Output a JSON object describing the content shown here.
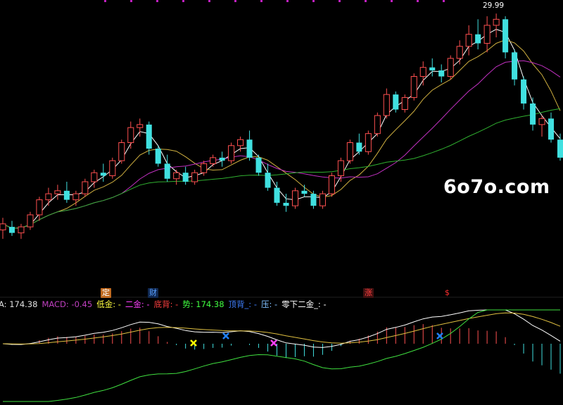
{
  "watermark": "6o7o.com",
  "markers": {
    "ding": "定",
    "cai": "财",
    "zhang": "涨",
    "s": "$"
  },
  "indicators": [
    {
      "text": "A: 174.38",
      "color": "#e0e0e0"
    },
    {
      "text": "MACD: -0.45",
      "color": "#c040c0"
    },
    {
      "text": "低金: -",
      "color": "#ffff40"
    },
    {
      "text": "二金: -",
      "color": "#ff40ff"
    },
    {
      "text": "底背: -",
      "color": "#ff4040"
    },
    {
      "text": "势: 174.38",
      "color": "#40ff40"
    },
    {
      "text": "顶背_: -",
      "color": "#4080ff"
    },
    {
      "text": "压: -",
      "color": "#80c0ff"
    },
    {
      "text": "零下二金_: -",
      "color": "#ffffff"
    }
  ],
  "chart_data": {
    "type": "candlestick",
    "high_label": "29.99",
    "candles": [
      [
        22.8,
        23.2,
        22.5,
        23.0
      ],
      [
        22.9,
        23.1,
        22.6,
        22.7
      ],
      [
        22.7,
        23.0,
        22.5,
        22.9
      ],
      [
        22.9,
        23.4,
        22.8,
        23.3
      ],
      [
        23.3,
        23.9,
        23.1,
        23.8
      ],
      [
        23.8,
        24.2,
        23.6,
        24.0
      ],
      [
        24.0,
        24.3,
        23.8,
        24.1
      ],
      [
        24.1,
        24.4,
        23.7,
        23.8
      ],
      [
        23.8,
        24.1,
        23.6,
        24.0
      ],
      [
        24.0,
        24.5,
        23.9,
        24.4
      ],
      [
        24.4,
        24.8,
        24.2,
        24.7
      ],
      [
        24.7,
        25.0,
        24.4,
        24.6
      ],
      [
        24.6,
        25.2,
        24.5,
        25.1
      ],
      [
        25.1,
        25.8,
        25.0,
        25.7
      ],
      [
        25.7,
        26.4,
        25.5,
        26.2
      ],
      [
        26.2,
        26.5,
        25.9,
        26.3
      ],
      [
        26.3,
        26.4,
        25.3,
        25.5
      ],
      [
        25.5,
        25.6,
        24.9,
        25.0
      ],
      [
        25.0,
        25.3,
        24.4,
        24.5
      ],
      [
        24.5,
        24.8,
        24.3,
        24.7
      ],
      [
        24.7,
        24.9,
        24.3,
        24.4
      ],
      [
        24.4,
        24.8,
        24.3,
        24.7
      ],
      [
        24.7,
        25.1,
        24.6,
        25.0
      ],
      [
        25.0,
        25.3,
        24.9,
        25.2
      ],
      [
        25.2,
        25.4,
        24.9,
        25.1
      ],
      [
        25.1,
        25.7,
        25.0,
        25.6
      ],
      [
        25.6,
        25.9,
        25.4,
        25.8
      ],
      [
        25.8,
        26.1,
        25.1,
        25.2
      ],
      [
        25.2,
        25.3,
        24.6,
        24.7
      ],
      [
        24.7,
        25.0,
        24.1,
        24.2
      ],
      [
        24.2,
        24.4,
        23.6,
        23.7
      ],
      [
        23.7,
        24.0,
        23.4,
        23.6
      ],
      [
        23.6,
        24.2,
        23.5,
        24.1
      ],
      [
        24.1,
        24.3,
        23.9,
        24.0
      ],
      [
        24.0,
        24.1,
        23.5,
        23.6
      ],
      [
        23.6,
        24.1,
        23.5,
        24.0
      ],
      [
        24.0,
        24.7,
        23.9,
        24.6
      ],
      [
        24.6,
        25.2,
        24.4,
        25.1
      ],
      [
        25.1,
        25.8,
        25.0,
        25.7
      ],
      [
        25.7,
        26.0,
        25.3,
        25.4
      ],
      [
        25.4,
        26.1,
        25.3,
        26.0
      ],
      [
        26.0,
        26.7,
        25.9,
        26.6
      ],
      [
        26.6,
        27.5,
        26.5,
        27.3
      ],
      [
        27.3,
        27.4,
        26.7,
        26.8
      ],
      [
        26.8,
        27.3,
        26.7,
        27.2
      ],
      [
        27.2,
        28.0,
        27.1,
        27.9
      ],
      [
        27.9,
        28.4,
        27.6,
        28.2
      ],
      [
        28.2,
        28.5,
        27.9,
        28.1
      ],
      [
        28.1,
        28.3,
        27.7,
        27.9
      ],
      [
        27.9,
        28.6,
        27.8,
        28.5
      ],
      [
        28.5,
        29.1,
        28.3,
        28.9
      ],
      [
        28.9,
        29.6,
        28.6,
        29.3
      ],
      [
        29.3,
        29.8,
        28.8,
        29.0
      ],
      [
        29.0,
        29.9,
        28.7,
        29.6
      ],
      [
        29.6,
        29.99,
        29.2,
        29.8
      ],
      [
        29.8,
        29.9,
        28.5,
        28.7
      ],
      [
        28.7,
        28.8,
        27.6,
        27.8
      ],
      [
        27.8,
        27.9,
        26.8,
        27.0
      ],
      [
        27.0,
        27.2,
        26.1,
        26.3
      ],
      [
        26.3,
        26.6,
        25.9,
        26.5
      ],
      [
        26.5,
        26.7,
        25.7,
        25.8
      ],
      [
        25.8,
        26.0,
        25.1,
        25.2
      ]
    ]
  }
}
